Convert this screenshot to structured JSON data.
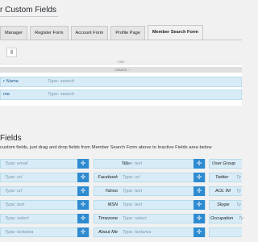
{
  "page": {
    "title": "r Custom Fields"
  },
  "tabs": [
    {
      "label": "Manager"
    },
    {
      "label": "Register Form"
    },
    {
      "label": "Account Form"
    },
    {
      "label": "Profile Page"
    },
    {
      "label": "Member Search Form"
    }
  ],
  "builder": {
    "row_label": "- row -",
    "column_label": "- column -",
    "rows": [
      {
        "label": "r Name",
        "value": "Type: search"
      },
      {
        "label": "me",
        "value": "Type: search"
      }
    ]
  },
  "inactive": {
    "title": "Fields",
    "description": "custom fields, just drag and drop fields from Member Search Form above to Inactive Fields area below",
    "col1": [
      {
        "value": "Type: email"
      },
      {
        "value": "Type: url"
      },
      {
        "value": "Type: url"
      },
      {
        "value": "Type: text"
      },
      {
        "value": "Type: select"
      },
      {
        "value": "Type: textarea"
      }
    ],
    "col2": [
      {
        "label": "Title",
        "value": "Type: text"
      },
      {
        "label": "Facebook",
        "value": "Type: url"
      },
      {
        "label": "Yahoo",
        "value": "Type: text"
      },
      {
        "label": "MSN",
        "value": "Type: text"
      },
      {
        "label": "Timezone",
        "value": "Type: select"
      },
      {
        "label": "About Me",
        "value": "Type: textarea"
      }
    ],
    "col3": [
      {
        "label": "User Group"
      },
      {
        "label": "Twitter",
        "value": "Ty"
      },
      {
        "label": "AOL IM",
        "value": "Ty"
      },
      {
        "label": "Skype",
        "value": "Ty"
      },
      {
        "label": "Occupation",
        "value": "Ty"
      }
    ]
  },
  "icons": {
    "move": "move-icon",
    "columns": "columns-icon"
  }
}
